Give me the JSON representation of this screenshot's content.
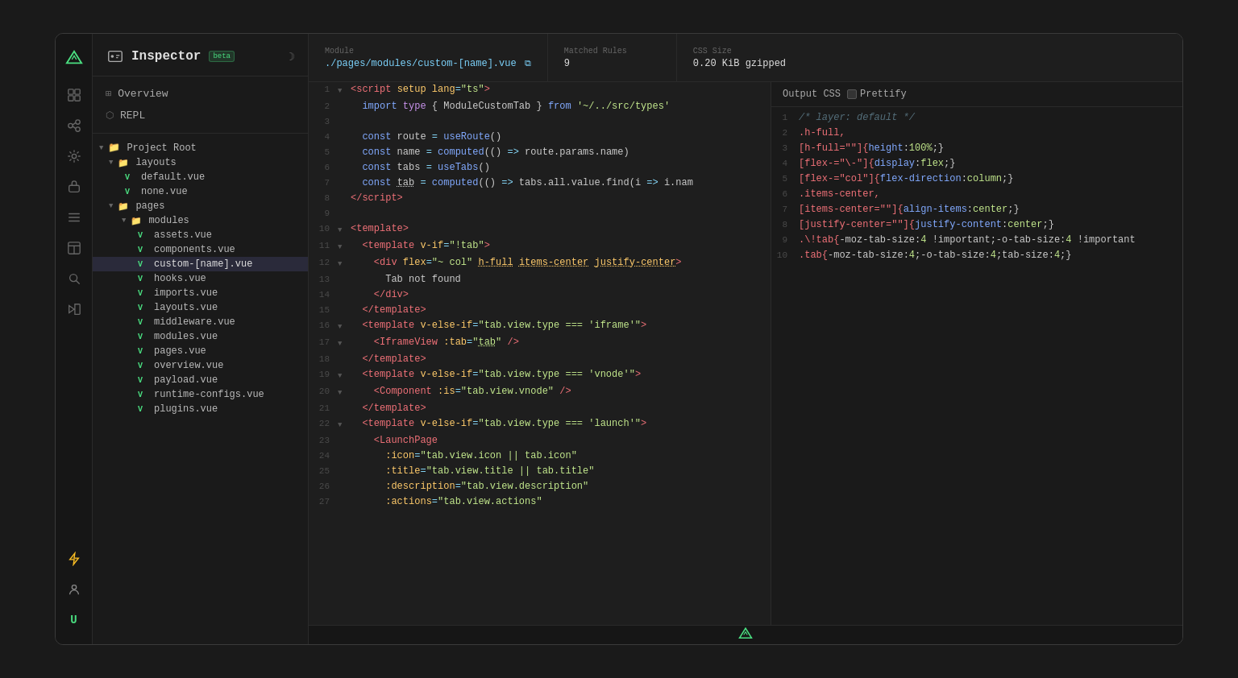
{
  "app": {
    "title": "Inspector",
    "beta_label": "beta",
    "window_bg": "#1e1e1e"
  },
  "header": {
    "module_label": "Module",
    "module_value": "./pages/modules/custom-[name].vue",
    "matched_rules_label": "Matched Rules",
    "matched_rules_value": "9",
    "css_size_label": "CSS Size",
    "css_size_value": "0.20 KiB gzipped"
  },
  "sidebar": {
    "overview_label": "Overview",
    "repl_label": "REPL",
    "project_root_label": "Project Root",
    "tree": [
      {
        "indent": 0,
        "type": "folder",
        "label": "layouts",
        "expanded": true
      },
      {
        "indent": 1,
        "type": "vue",
        "label": "default.vue"
      },
      {
        "indent": 1,
        "type": "vue",
        "label": "none.vue"
      },
      {
        "indent": 0,
        "type": "folder",
        "label": "pages",
        "expanded": true
      },
      {
        "indent": 1,
        "type": "folder",
        "label": "modules",
        "expanded": true
      },
      {
        "indent": 2,
        "type": "vue",
        "label": "assets.vue"
      },
      {
        "indent": 2,
        "type": "vue",
        "label": "components.vue"
      },
      {
        "indent": 2,
        "type": "vue",
        "label": "custom-[name].vue",
        "active": true
      },
      {
        "indent": 2,
        "type": "vue",
        "label": "hooks.vue"
      },
      {
        "indent": 2,
        "type": "vue",
        "label": "imports.vue"
      },
      {
        "indent": 2,
        "type": "vue",
        "label": "layouts.vue"
      },
      {
        "indent": 2,
        "type": "vue",
        "label": "middleware.vue"
      },
      {
        "indent": 2,
        "type": "vue",
        "label": "modules.vue"
      },
      {
        "indent": 2,
        "type": "vue",
        "label": "pages.vue"
      },
      {
        "indent": 2,
        "type": "vue",
        "label": "overview.vue"
      },
      {
        "indent": 2,
        "type": "vue",
        "label": "payload.vue"
      },
      {
        "indent": 2,
        "type": "vue",
        "label": "runtime-configs.vue"
      },
      {
        "indent": 2,
        "type": "vue",
        "label": "plugins.vue"
      }
    ]
  },
  "code_editor": {
    "lines": [
      {
        "num": 1,
        "has_chevron": true,
        "code": "<span class='tag'>&lt;script</span> <span class='attr'>setup</span> <span class='attr'>lang</span><span class='punct'>=</span><span class='str'>\"ts\"</span><span class='tag'>&gt;</span>"
      },
      {
        "num": 2,
        "has_chevron": false,
        "code": "  <span class='kw2'>import</span> <span class='kw'>type</span> { ModuleCustomTab } <span class='kw2'>from</span> <span class='str'>'~/../src/types'</span>"
      },
      {
        "num": 3,
        "has_chevron": false,
        "code": ""
      },
      {
        "num": 4,
        "has_chevron": false,
        "code": "  <span class='kw2'>const</span> route <span class='punct'>=</span> <span class='fn'>useRoute</span>()"
      },
      {
        "num": 5,
        "has_chevron": false,
        "code": "  <span class='kw2'>const</span> name <span class='punct'>=</span> <span class='fn'>computed</span>(() <span class='punct'>=&gt;</span> route.params.name)"
      },
      {
        "num": 6,
        "has_chevron": false,
        "code": "  <span class='kw2'>const</span> tabs <span class='punct'>=</span> <span class='fn'>useTabs</span>()"
      },
      {
        "num": 7,
        "has_chevron": false,
        "code": "  <span class='kw2'>const</span> <span style='text-decoration:underline'>tab</span> <span class='punct'>=</span> <span class='fn'>computed</span>(() <span class='punct'>=&gt;</span> tabs.all.value.find(i <span class='punct'>=&gt;</span> i.nam"
      },
      {
        "num": 8,
        "has_chevron": false,
        "code": "<span class='tag'>&lt;/script&gt;</span>"
      },
      {
        "num": 9,
        "has_chevron": false,
        "code": ""
      },
      {
        "num": 10,
        "has_chevron": true,
        "code": "<span class='tag'>&lt;template&gt;</span>"
      },
      {
        "num": 11,
        "has_chevron": true,
        "code": "  <span class='tag'>&lt;template</span> <span class='attr'>v-if</span><span class='punct'>=</span><span class='str'>\"!tab\"</span><span class='tag'>&gt;</span>"
      },
      {
        "num": 12,
        "has_chevron": true,
        "code": "    <span class='tag'>&lt;div</span> <span class='attr'>flex</span><span class='punct'>=</span><span class='str'>\"~ col\"</span> <span style='text-decoration:underline' class='attr'>h-full</span> <span style='text-decoration:underline' class='attr'>items-center</span> <span style='text-decoration:underline' class='attr'>justify-center</span><span class='tag'>&gt;</span>"
      },
      {
        "num": 13,
        "has_chevron": false,
        "code": "      Tab not found"
      },
      {
        "num": 14,
        "has_chevron": false,
        "code": "    <span class='tag'>&lt;/div&gt;</span>"
      },
      {
        "num": 15,
        "has_chevron": false,
        "code": "  <span class='tag'>&lt;/template&gt;</span>"
      },
      {
        "num": 16,
        "has_chevron": true,
        "code": "  <span class='tag'>&lt;template</span> <span class='attr'>v-else-if</span><span class='punct'>=</span><span class='str'>\"tab.view.type === 'iframe'\"</span><span class='tag'>&gt;</span>"
      },
      {
        "num": 17,
        "has_chevron": true,
        "code": "    <span class='tag'>&lt;IframeView</span> <span class='attr'>:tab</span><span class='punct'>=</span><span class='str'>\"<span style='text-decoration:underline'>tab</span>\"</span> <span class='tag'>/&gt;</span>"
      },
      {
        "num": 18,
        "has_chevron": false,
        "code": "  <span class='tag'>&lt;/template&gt;</span>"
      },
      {
        "num": 19,
        "has_chevron": true,
        "code": "  <span class='tag'>&lt;template</span> <span class='attr'>v-else-if</span><span class='punct'>=</span><span class='str'>\"tab.view.type === 'vnode'\"</span><span class='tag'>&gt;</span>"
      },
      {
        "num": 20,
        "has_chevron": true,
        "code": "    <span class='tag'>&lt;Component</span> <span class='attr'>:is</span><span class='punct'>=</span><span class='str'>\"tab.view.vnode\"</span> <span class='tag'>/&gt;</span>"
      },
      {
        "num": 21,
        "has_chevron": false,
        "code": "  <span class='tag'>&lt;/template&gt;</span>"
      },
      {
        "num": 22,
        "has_chevron": true,
        "code": "  <span class='tag'>&lt;template</span> <span class='attr'>v-else-if</span><span class='punct'>=</span><span class='str'>\"tab.view.type === 'launch'\"</span><span class='tag'>&gt;</span>"
      },
      {
        "num": 23,
        "has_chevron": false,
        "code": "    <span class='tag'>&lt;LaunchPage</span>"
      },
      {
        "num": 24,
        "has_chevron": false,
        "code": "      <span class='attr'>:icon</span><span class='punct'>=</span><span class='str'>\"tab.view.icon || tab.icon\"</span>"
      },
      {
        "num": 25,
        "has_chevron": false,
        "code": "      <span class='attr'>:title</span><span class='punct'>=</span><span class='str'>\"tab.view.title || tab.title\"</span>"
      },
      {
        "num": 26,
        "has_chevron": false,
        "code": "      <span class='attr'>:description</span><span class='punct'>=</span><span class='str'>\"tab.view.description\"</span>"
      },
      {
        "num": 27,
        "has_chevron": false,
        "code": "      <span class='attr'>:actions</span><span class='punct'>=</span><span class='str'>\"tab.view.actions\"</span>"
      }
    ]
  },
  "css_output": {
    "title": "Output CSS",
    "prettify_label": "Prettify",
    "lines": [
      {
        "num": 1,
        "code": "<span class='css-comment'>/* layer: default */</span>"
      },
      {
        "num": 2,
        "code": "<span class='css-sel'>.h-full,</span>"
      },
      {
        "num": 3,
        "code": "<span class='css-sel'>[h-full=\"\"]{</span><span class='css-prop'>height</span>:<span class='css-val'>100%</span>;}"
      },
      {
        "num": 4,
        "code": "<span class='css-sel'>[flex-=\"\\-\"]{</span><span class='css-prop'>display</span>:<span class='css-val'>flex</span>;}"
      },
      {
        "num": 5,
        "code": "<span class='css-sel'>[flex-=\"col\"]{</span><span class='css-prop'>flex-direction</span>:<span class='css-val'>column</span>;}"
      },
      {
        "num": 6,
        "code": "<span class='css-sel'>.items-center,</span>"
      },
      {
        "num": 7,
        "code": "<span class='css-sel'>[items-center=\"\"]{</span><span class='css-prop'>align-items</span>:<span class='css-val'>center</span>;}"
      },
      {
        "num": 8,
        "code": "<span class='css-sel'>[justify-center=\"\"]{</span><span class='css-prop'>justify-content</span>:<span class='css-val'>center</span>;}"
      },
      {
        "num": 9,
        "code": "<span class='css-sel'>.\\!tab{</span>-moz-tab-size:<span class='css-val'>4</span> !important;-o-tab-size:<span class='css-val'>4</span> !important"
      },
      {
        "num": 10,
        "code": "<span class='css-sel'>.tab{</span>-moz-tab-size:<span class='css-val'>4</span>;-o-tab-size:<span class='css-val'>4</span>;tab-size:<span class='css-val'>4</span>;}"
      }
    ]
  },
  "icons": {
    "brand_icon": "△",
    "overview_icon": "⊞",
    "repl_icon": "⬡",
    "connections_icon": "◎",
    "settings_icon": "⚙",
    "plugin_icon": "⚡",
    "search_icon": "⌕",
    "debug_icon": "◆",
    "layers_icon": "≡",
    "zoom_icon": "⊕",
    "vscode_icon": "◧",
    "bolt_icon": "⚡",
    "circle_icon": "●",
    "u_icon": "Ü",
    "moon_icon": "☽",
    "folder_icon": "📁",
    "vue_v": "V"
  }
}
